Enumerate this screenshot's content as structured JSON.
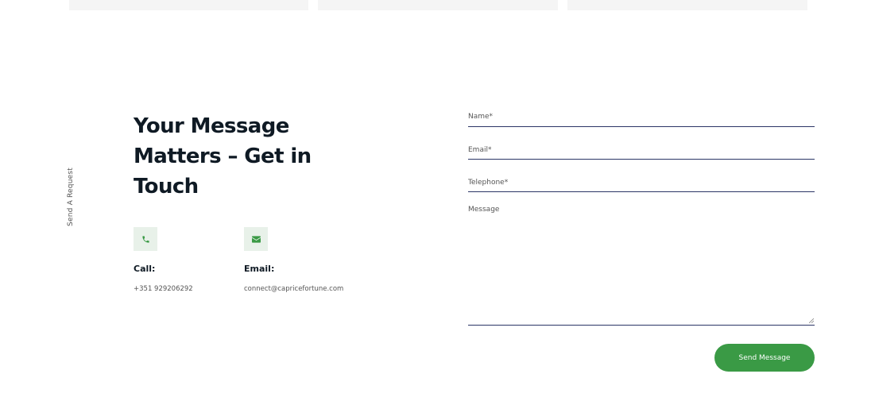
{
  "section": {
    "vertical_label": "Send A Request",
    "heading": "Your Message Matters – Get in Touch"
  },
  "contacts": {
    "call": {
      "icon": "phone-icon",
      "label": "Call:",
      "value": "+351 929206292"
    },
    "email": {
      "icon": "envelope-icon",
      "label": "Email:",
      "value": "connect@capricefortune.com"
    }
  },
  "form": {
    "name_placeholder": "Name*",
    "email_placeholder": "Email*",
    "telephone_placeholder": "Telephone*",
    "message_placeholder": "Message",
    "submit_label": "Send Message"
  },
  "colors": {
    "accent": "#3a9a45",
    "icon_bg": "#e8f1e9",
    "field_line": "#2b3566",
    "heading": "#0f1a24"
  }
}
